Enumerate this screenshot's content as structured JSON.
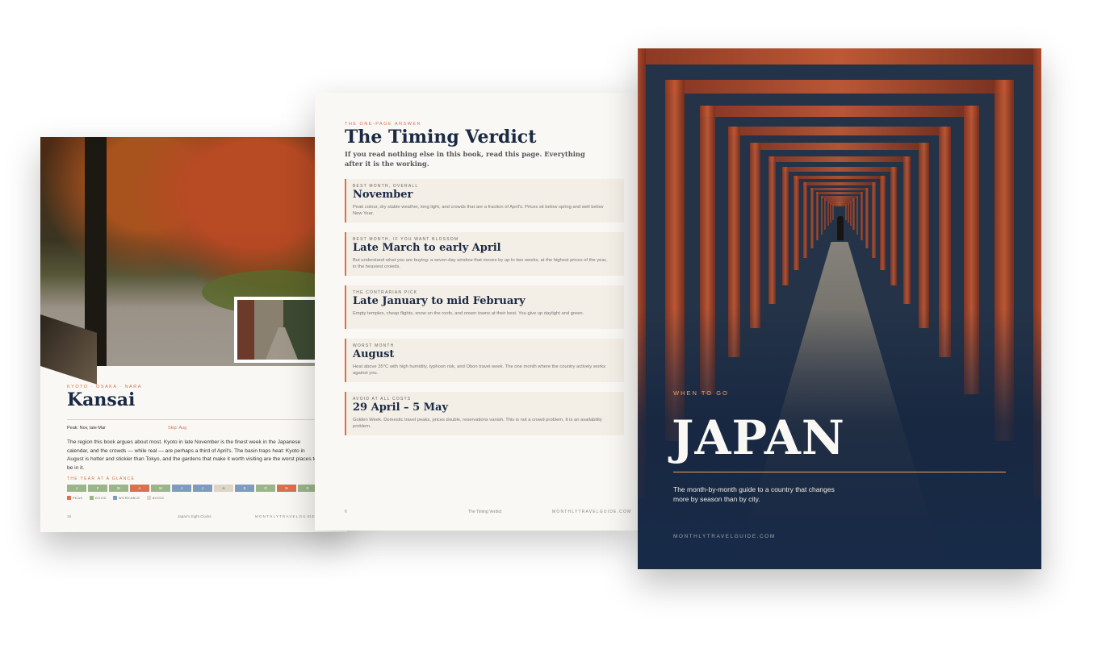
{
  "left_page": {
    "kicker": "KYOTO · OSAKA · NARA",
    "title": "Kansai",
    "peak": "Peak: Nov, late Mar",
    "skip": "Skip: Aug",
    "body": "The region this book argues about most. Kyoto in late November is the finest week in the Japanese calendar, and the crowds — while real — are perhaps a third of April's. The basin traps heat: Kyoto in August is hotter and stickier than Tokyo, and the gardens that make it worth visiting are the worst places to be in it.",
    "year_title": "THE YEAR AT A GLANCE",
    "months": [
      {
        "label": "J",
        "status": "good"
      },
      {
        "label": "F",
        "status": "good"
      },
      {
        "label": "M",
        "status": "good"
      },
      {
        "label": "A",
        "status": "peak"
      },
      {
        "label": "M",
        "status": "good"
      },
      {
        "label": "J",
        "status": "workable"
      },
      {
        "label": "J",
        "status": "workable"
      },
      {
        "label": "A",
        "status": "avoid"
      },
      {
        "label": "S",
        "status": "workable"
      },
      {
        "label": "O",
        "status": "good"
      },
      {
        "label": "N",
        "status": "peak"
      },
      {
        "label": "D",
        "status": "good"
      }
    ],
    "legend": [
      {
        "label": "PEAK",
        "color": "#d9714e"
      },
      {
        "label": "GOOD",
        "color": "#9bb58a"
      },
      {
        "label": "WORKABLE",
        "color": "#7f9cc0"
      },
      {
        "label": "AVOID",
        "color": "#ddd5c6"
      }
    ],
    "footer": {
      "page": "16",
      "section": "Japan's Eight Clocks",
      "site": "MONTHLYTRAVELGUIDE.COM"
    }
  },
  "middle_page": {
    "kicker": "THE ONE-PAGE ANSWER",
    "title": "The Timing Verdict",
    "subtitle": "If you read nothing else in this book, read this page. Everything after it is the working.",
    "cards": [
      {
        "label": "BEST MONTH, OVERALL",
        "title": "November",
        "text": "Peak colour, dry stable weather, long light, and crowds that are a fraction of April's. Prices sit below spring and well below New Year."
      },
      {
        "label": "BEST MONTH, IF YOU WANT BLOSSOM",
        "title": "Late March to early April",
        "text": "But understand what you are buying: a seven-day window that moves by up to two weeks, at the highest prices of the year, in the heaviest crowds."
      },
      {
        "label": "THE CONTRARIAN PICK",
        "title": "Late January to mid February",
        "text": "Empty temples, cheap flights, snow on the roofs, and onsen towns at their best. You give up daylight and green."
      },
      {
        "label": "WORST MONTH",
        "title": "August",
        "text": "Heat above 35°C with high humidity, typhoon risk, and Obon travel week. The one month where the country actively works against you."
      },
      {
        "label": "AVOID AT ALL COSTS",
        "title": "29 April – 5 May",
        "text": "Golden Week. Domestic travel peaks, prices double, reservations vanish. This is not a crowd problem. It is an availability problem."
      }
    ],
    "footer": {
      "page": "6",
      "section": "The Timing Verdict",
      "site": "MONTHLYTRAVELGUIDE.COM"
    }
  },
  "cover": {
    "kicker": "WHEN TO GO",
    "title": "JAPAN",
    "subtitle": "The month-by-month guide to a country that changes more by season than by city.",
    "url": "MONTHLYTRAVELGUIDE.COM"
  },
  "colors": {
    "accent": "#d9714e",
    "navy": "#1a2a44",
    "paper": "#faf8f4",
    "card": "#f3eee6"
  }
}
